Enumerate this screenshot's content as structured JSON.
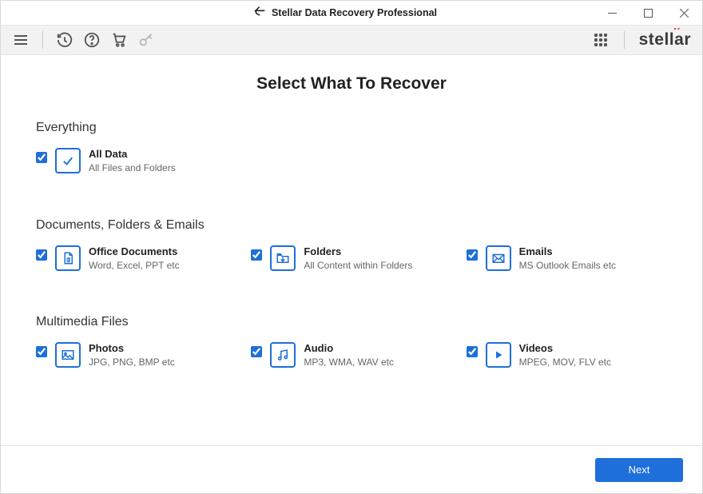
{
  "window": {
    "title": "Stellar Data Recovery Professional"
  },
  "brand": "stellar",
  "page_title": "Select What To Recover",
  "sections": {
    "everything": {
      "title": "Everything",
      "all_data": {
        "title": "All Data",
        "sub": "All Files and Folders"
      }
    },
    "docs": {
      "title": "Documents, Folders & Emails",
      "office": {
        "title": "Office Documents",
        "sub": "Word, Excel, PPT etc"
      },
      "folders": {
        "title": "Folders",
        "sub": "All Content within Folders"
      },
      "emails": {
        "title": "Emails",
        "sub": "MS Outlook Emails etc"
      }
    },
    "multimedia": {
      "title": "Multimedia Files",
      "photos": {
        "title": "Photos",
        "sub": "JPG, PNG, BMP etc"
      },
      "audio": {
        "title": "Audio",
        "sub": "MP3, WMA, WAV etc"
      },
      "videos": {
        "title": "Videos",
        "sub": "MPEG, MOV, FLV etc"
      }
    }
  },
  "footer": {
    "next": "Next"
  }
}
